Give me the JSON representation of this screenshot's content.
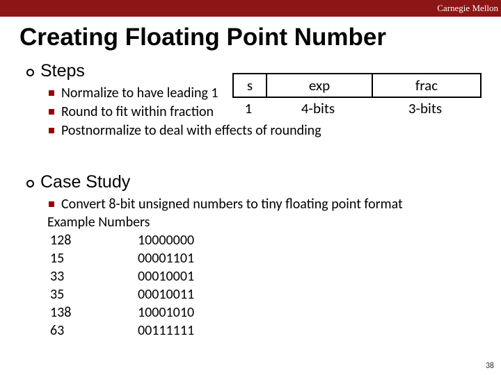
{
  "brand": "Carnegie Mellon",
  "title": "Creating Floating Point Number",
  "section1": {
    "heading": "Steps",
    "items": [
      "Normalize to have leading 1",
      "Round to fit within fraction",
      "Postnormalize to deal with effects of rounding"
    ]
  },
  "diagram": {
    "headers": {
      "s": "s",
      "exp": "exp",
      "frac": "frac"
    },
    "labels": {
      "s": "1",
      "exp": "4-bits",
      "frac": "3-bits"
    }
  },
  "section2": {
    "heading": "Case Study",
    "item": "Convert 8-bit unsigned numbers to tiny floating point format",
    "example_label": "Example Numbers",
    "rows": [
      {
        "dec": "128",
        "bin": "10000000"
      },
      {
        "dec": " 15",
        "bin": "00001101"
      },
      {
        "dec": " 33",
        "bin": "00010001"
      },
      {
        "dec": " 35",
        "bin": "00010011"
      },
      {
        "dec": "138",
        "bin": "10001010"
      },
      {
        "dec": " 63",
        "bin": "00111111"
      }
    ]
  },
  "page_number": "38"
}
